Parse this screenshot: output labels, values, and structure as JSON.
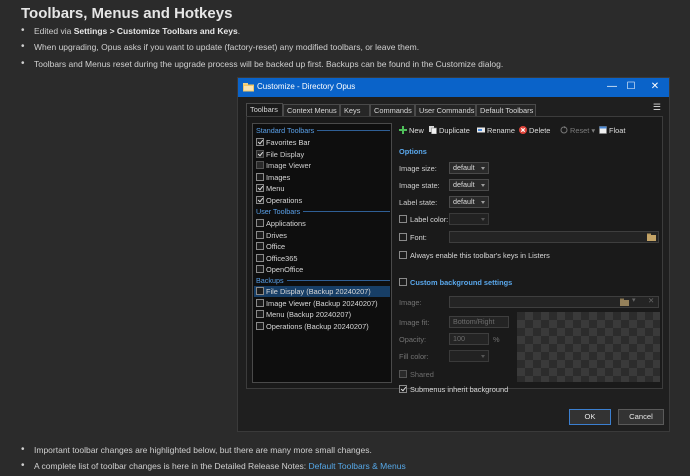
{
  "page": {
    "heading": "Toolbars, Menus and Hotkeys",
    "bullets_top": [
      {
        "pre": "Edited via ",
        "bold": "Settings > Customize Toolbars and Keys",
        "post": "."
      },
      {
        "pre": "When upgrading, Opus asks if you want to update (factory-reset) any modified toolbars, or leave them.",
        "bold": "",
        "post": ""
      },
      {
        "pre": "Toolbars and Menus reset during the upgrade process will be backed up first. Backups can be found in the Customize dialog.",
        "bold": "",
        "post": ""
      }
    ],
    "bullets_bottom": [
      {
        "text": "Important toolbar changes are highlighted below, but there are many more small changes."
      },
      {
        "text": "A complete list of toolbar changes is here in the Detailed Release Notes: ",
        "link": "Default Toolbars & Menus"
      }
    ]
  },
  "window": {
    "title": "Customize - Directory Opus",
    "controls": {
      "minimize": "—",
      "maximize": "☐",
      "close": "✕"
    },
    "tabs": [
      "Toolbars",
      "Context Menus",
      "Keys",
      "Commands",
      "User Commands",
      "Default Toolbars"
    ],
    "menu_glyph": "☰",
    "list": {
      "groups": [
        {
          "title": "Standard Toolbars",
          "items": [
            {
              "label": "Favorites Bar",
              "checked": true
            },
            {
              "label": "File Display",
              "checked": true,
              "disabled": true
            },
            {
              "label": "Image Viewer",
              "checked": false,
              "disabled": true
            },
            {
              "label": "Images",
              "checked": false
            },
            {
              "label": "Menu",
              "checked": true
            },
            {
              "label": "Operations",
              "checked": true
            }
          ]
        },
        {
          "title": "User Toolbars",
          "items": [
            {
              "label": "Applications",
              "checked": false
            },
            {
              "label": "Drives",
              "checked": false
            },
            {
              "label": "Office",
              "checked": false
            },
            {
              "label": "Office365",
              "checked": false
            },
            {
              "label": "OpenOffice",
              "checked": false
            }
          ]
        },
        {
          "title": "Backups",
          "items": [
            {
              "label": "File Display (Backup 20240207)",
              "checked": false,
              "selected": true
            },
            {
              "label": "Image Viewer (Backup 20240207)",
              "checked": false
            },
            {
              "label": "Menu (Backup 20240207)",
              "checked": false
            },
            {
              "label": "Operations (Backup 20240207)",
              "checked": false
            }
          ]
        }
      ]
    },
    "toolbar": {
      "new": "New",
      "duplicate": "Duplicate",
      "rename": "Rename",
      "delete": "Delete",
      "reset": "Reset",
      "float": "Float"
    },
    "options": {
      "section_title": "Options",
      "image_size_label": "Image size:",
      "image_size_value": "default",
      "image_state_label": "Image state:",
      "image_state_value": "default",
      "label_state_label": "Label state:",
      "label_state_value": "default",
      "label_color_label": "Label color:",
      "font_label": "Font:",
      "always_enable_label": "Always enable this toolbar's keys in Listers"
    },
    "background": {
      "section_title": "Custom background settings",
      "image_label": "Image:",
      "image_fit_label": "Image fit:",
      "image_fit_value": "Bottom/Right",
      "opacity_label": "Opacity:",
      "opacity_value": "100",
      "opacity_unit": "%",
      "fill_color_label": "Fill color:",
      "shared_label": "Shared",
      "submenus_label": "Submenus inherit background",
      "submenus_checked": true
    },
    "buttons": {
      "ok": "OK",
      "cancel": "Cancel"
    },
    "colors": {
      "titlebar": "#0a63c9",
      "accent": "#5aa8ec",
      "selection": "#173e66"
    }
  }
}
